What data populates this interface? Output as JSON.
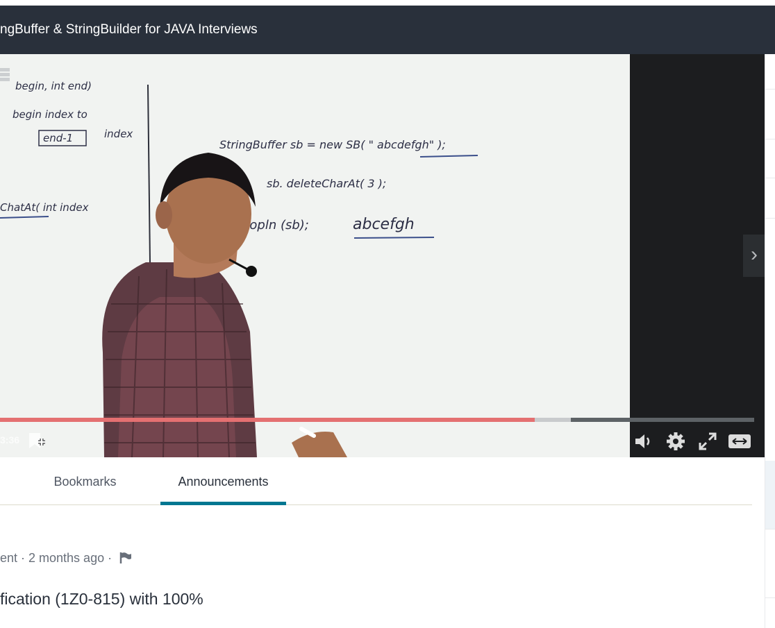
{
  "header": {
    "title": "ngBuffer & StringBuilder for JAVA Interviews"
  },
  "player": {
    "current_time": "3:36",
    "progress": 0.709,
    "buffered": 0.757,
    "whiteboard": {
      "left_lines": [
        "begin, int end)",
        "begin index to",
        "end-1",
        "index",
        "ChatAt( int  index"
      ],
      "right_lines": [
        "StringBuffer  sb = new  SB( \" abcdefgh\" );",
        "sb. deleteCharAt( 3 );",
        "sopln (sb);",
        "abcefgh"
      ]
    }
  },
  "tabs": [
    {
      "label": "Bookmarks",
      "active": false
    },
    {
      "label": "Announcements",
      "active": true
    }
  ],
  "announcement": {
    "meta": "ent · 2 months ago ·",
    "title": "fication (1Z0-815) with 100%"
  },
  "colors": {
    "accent": "#007791",
    "header_bg": "#29303b",
    "progress": "#ec5252"
  }
}
